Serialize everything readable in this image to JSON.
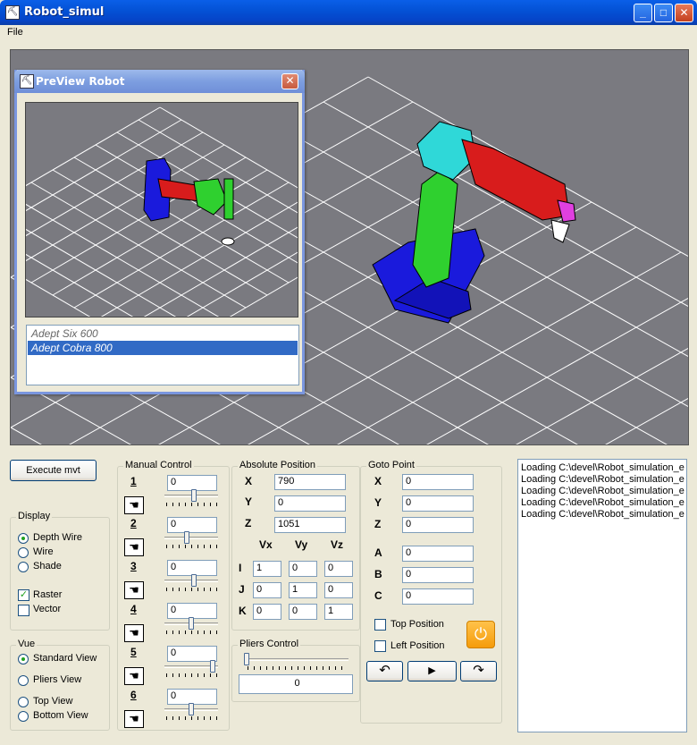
{
  "window": {
    "title": "Robot_simul",
    "minimize": "_",
    "maximize": "□",
    "close": "✕"
  },
  "menu": {
    "file": "File"
  },
  "preview": {
    "title": "PreView Robot",
    "close": "✕",
    "robots": [
      "Adept Six 600",
      "Adept Cobra 800"
    ],
    "selected_index": 1
  },
  "buttons": {
    "execute": "Execute mvt"
  },
  "display": {
    "label": "Display",
    "options": [
      "Depth Wire",
      "Wire",
      "Shade"
    ],
    "selected": "Depth Wire",
    "raster_label": "Raster",
    "raster_checked": true,
    "vector_label": "Vector",
    "vector_checked": false
  },
  "vue": {
    "label": "Vue",
    "options": [
      "Standard View",
      "Pliers View",
      "Top View",
      "Bottom View"
    ],
    "selected": "Standard View"
  },
  "manual": {
    "label": "Manual Control",
    "axes": [
      {
        "num": "1",
        "value": "0",
        "slider": 0.55
      },
      {
        "num": "2",
        "value": "0",
        "slider": 0.4
      },
      {
        "num": "3",
        "value": "0",
        "slider": 0.55
      },
      {
        "num": "4",
        "value": "0",
        "slider": 0.5
      },
      {
        "num": "5",
        "value": "0",
        "slider": 0.95
      },
      {
        "num": "6",
        "value": "0",
        "slider": 0.5
      }
    ],
    "jog_icon": "hand-point-icon"
  },
  "absolute": {
    "label": "Absolute Position",
    "x_label": "X",
    "x": "790",
    "y_label": "Y",
    "y": "0",
    "z_label": "Z",
    "z": "1051",
    "col_labels": [
      "Vx",
      "Vy",
      "Vz"
    ],
    "rows": [
      {
        "label": "I",
        "values": [
          "1",
          "0",
          "0"
        ]
      },
      {
        "label": "J",
        "values": [
          "0",
          "1",
          "0"
        ]
      },
      {
        "label": "K",
        "values": [
          "0",
          "0",
          "1"
        ]
      }
    ]
  },
  "pliers": {
    "label": "Pliers Control",
    "value": "0",
    "slider": 0.0
  },
  "goto": {
    "label": "Goto Point",
    "fields": [
      {
        "label": "X",
        "value": "0"
      },
      {
        "label": "Y",
        "value": "0"
      },
      {
        "label": "Z",
        "value": "0"
      },
      {
        "label": "A",
        "value": "0"
      },
      {
        "label": "B",
        "value": "0"
      },
      {
        "label": "C",
        "value": "0"
      }
    ],
    "top_position": "Top Position",
    "left_position": "Left Position",
    "undo_icon": "↶",
    "play_icon": "▶",
    "redo_icon": "↷",
    "power_icon": "⏻"
  },
  "log": {
    "lines": [
      "Loading C:\\devel\\Robot_simulation_e",
      "Loading C:\\devel\\Robot_simulation_e",
      "Loading C:\\devel\\Robot_simulation_e",
      "Loading C:\\devel\\Robot_simulation_e",
      "Loading C:\\devel\\Robot_simulation_e"
    ]
  },
  "colors": {
    "viewport_bg": "#7a7a80",
    "grid": "#ffffff",
    "robot_base": "#1a1adc",
    "robot_arm_green": "#2fd02f",
    "robot_arm_red": "#d81c1c",
    "robot_cyan": "#2fd8d8",
    "robot_tool": "#e040e0",
    "selection": "#316ac5"
  }
}
